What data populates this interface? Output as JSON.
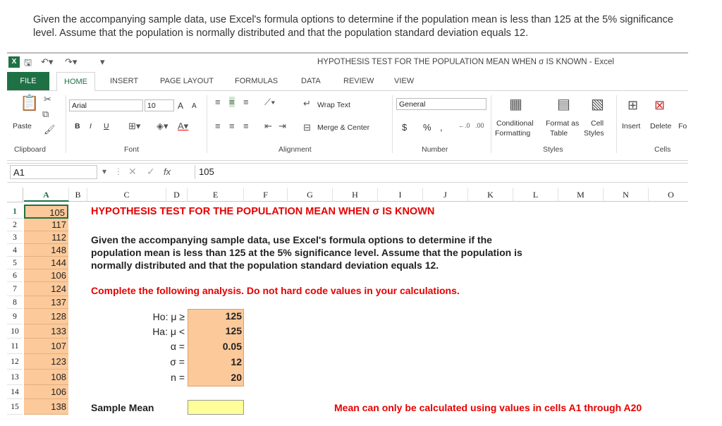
{
  "question": "Given the accompanying sample data, use Excel's formula options to determine if the population mean is less than 125 at the 5% significance level. Assume that the population is normally distributed and that the population standard deviation equals 12.",
  "window": {
    "title": "HYPOTHESIS TEST FOR THE POPULATION MEAN WHEN σ IS KNOWN - Excel",
    "logo": "X"
  },
  "tabs": [
    "FILE",
    "HOME",
    "INSERT",
    "PAGE LAYOUT",
    "FORMULAS",
    "DATA",
    "REVIEW",
    "VIEW"
  ],
  "ribbon": {
    "paste": "Paste",
    "font_name": "Arial",
    "font_size": "10",
    "bold": "B",
    "italic": "I",
    "underline": "U",
    "grow": "A",
    "shrink": "A",
    "wrap_text": "Wrap Text",
    "merge_center": "Merge & Center",
    "number_format": "General",
    "currency": "$",
    "percent": "%",
    "comma": ",",
    "conditional1": "Conditional",
    "conditional2": "Formatting",
    "format_as1": "Format as",
    "format_as2": "Table",
    "cell_styles1": "Cell",
    "cell_styles2": "Styles",
    "insert": "Insert",
    "delete": "Delete",
    "format": "Fo",
    "groups": {
      "clipboard": "Clipboard",
      "font": "Font",
      "alignment": "Alignment",
      "number": "Number",
      "styles": "Styles",
      "cells": "Cells"
    }
  },
  "formula_bar": {
    "name_box": "A1",
    "fx": "fx",
    "value": "105"
  },
  "columns": [
    "A",
    "B",
    "C",
    "D",
    "E",
    "F",
    "G",
    "H",
    "I",
    "J",
    "K",
    "L",
    "M",
    "N",
    "O"
  ],
  "rows": [
    "1",
    "2",
    "3",
    "4",
    "5",
    "6",
    "7",
    "8",
    "9",
    "10",
    "11",
    "12",
    "13",
    "14",
    "15"
  ],
  "col_a": [
    "105",
    "117",
    "112",
    "148",
    "144",
    "106",
    "124",
    "137",
    "128",
    "133",
    "107",
    "123",
    "108",
    "106",
    "138"
  ],
  "sheet": {
    "heading": "HYPOTHESIS TEST FOR THE POPULATION MEAN WHEN σ IS KNOWN",
    "desc1": "Given the accompanying sample data, use Excel's formula options to determine if the",
    "desc2": "population mean is less than 125 at the 5% significance level. Assume that the population is",
    "desc3": "normally distributed and that the population standard deviation equals 12.",
    "instruction": "Complete the following analysis. Do not hard code values in your calculations.",
    "h0_label": "Ho: μ ≥",
    "h0_value": "125",
    "ha_label": "Ha: μ <",
    "ha_value": "125",
    "alpha_label": "α =",
    "alpha_value": "0.05",
    "sigma_label": "σ =",
    "sigma_value": "12",
    "n_label": "n =",
    "n_value": "20",
    "sample_mean_label": "Sample Mean",
    "note": "Mean can only be calculated using values in cells A1 through A20"
  },
  "colors": {
    "excel_green": "#1e7145",
    "orange_fill": "#fcc99a",
    "yellow_fill": "#ffff99",
    "red_text": "#e60000"
  }
}
